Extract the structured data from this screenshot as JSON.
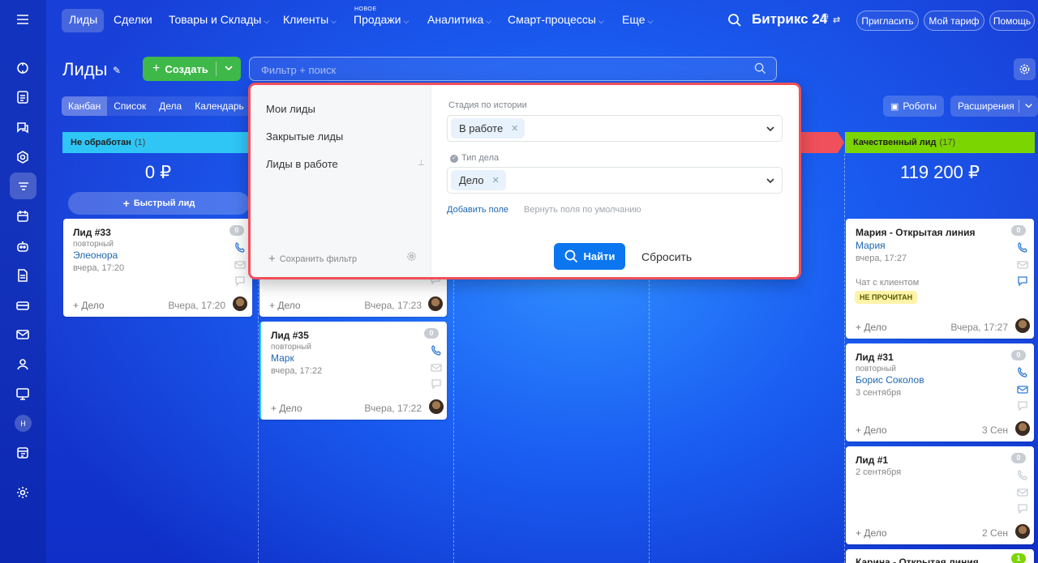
{
  "nav": {
    "items": [
      "Лиды",
      "Сделки",
      "Товары и Склады",
      "Клиенты",
      "Продажи",
      "Аналитика",
      "Смарт-процессы",
      "Еще"
    ],
    "new_badge": "НОВОЕ",
    "brand": "Битрикс 24",
    "invite": "Пригласить",
    "tariff": "Мой тариф",
    "help": "Помощь"
  },
  "toolbar": {
    "title": "Лиды",
    "create": "Создать",
    "search_placeholder": "Фильтр + поиск",
    "views": [
      "Канбан",
      "Список",
      "Дела",
      "Календарь"
    ],
    "robots": "Роботы",
    "extensions": "Расширения"
  },
  "sidebar": {
    "avatar_initial": "Н",
    "icons": [
      "menu-icon",
      "activity-icon",
      "tasks-icon",
      "chat-icon",
      "crm-icon",
      "funnel-icon",
      "calendar-icon",
      "robot-icon",
      "document-icon",
      "payments-icon",
      "mail-icon",
      "contacts-icon",
      "sites-icon",
      "avatar",
      "timesheet-icon",
      "settings-icon"
    ]
  },
  "columns": [
    {
      "title": "Не обработан",
      "count": "(1)",
      "sum": "0 ₽",
      "color": "#2fc6f6",
      "quick": "Быстрый лид"
    },
    {
      "title": "Качественный лид",
      "count": "(17)",
      "sum": "119 200 ₽",
      "color": "#7bd500"
    }
  ],
  "cards": {
    "c33": {
      "title": "Лид #33",
      "sub": "повторный",
      "contact": "Элеонора",
      "time": "вчера, 17:20",
      "action": "+ Дело",
      "date": "Вчера, 17:20",
      "badge": "0"
    },
    "cPrev": {
      "action": "+ Дело",
      "date": "Вчера, 17:23"
    },
    "c35": {
      "title": "Лид #35",
      "sub": "повторный",
      "contact": "Марк",
      "time": "вчера, 17:22",
      "action": "+ Дело",
      "date": "Вчера, 17:22",
      "badge": "0"
    },
    "cMaria": {
      "title": "Мария - Открытая линия",
      "contact": "Мария",
      "time": "вчера, 17:27",
      "chat": "Чат с клиентом",
      "tag": "НЕ ПРОЧИТАН",
      "action": "+ Дело",
      "date": "Вчера, 17:27",
      "badge": "0"
    },
    "c31": {
      "title": "Лид #31",
      "sub": "повторный",
      "contact": "Борис Соколов",
      "time": "3 сентября",
      "action": "+ Дело",
      "date": "3 Сен",
      "badge": "0"
    },
    "c1": {
      "title": "Лид #1",
      "time": "2 сентября",
      "action": "+ Дело",
      "date": "2 Сен",
      "badge": "0"
    },
    "cKarina": {
      "title": "Карина - Открытая линия",
      "badge": "1"
    }
  },
  "filter": {
    "presets": [
      "Мои лиды",
      "Закрытые лиды",
      "Лиды в работе"
    ],
    "save": "Сохранить фильтр",
    "stage_label": "Стадия по истории",
    "stage_value": "В работе",
    "type_label": "Тип дела",
    "type_value": "Дело",
    "add_field": "Добавить поле",
    "restore": "Вернуть поля по умолчанию",
    "find": "Найти",
    "reset": "Сбросить"
  },
  "colors": {
    "accent": "#0b76ef",
    "create": "#3fb84a",
    "highlight": "#f0505b",
    "new_col": "#2fc6f6",
    "good_col": "#7bd500"
  }
}
